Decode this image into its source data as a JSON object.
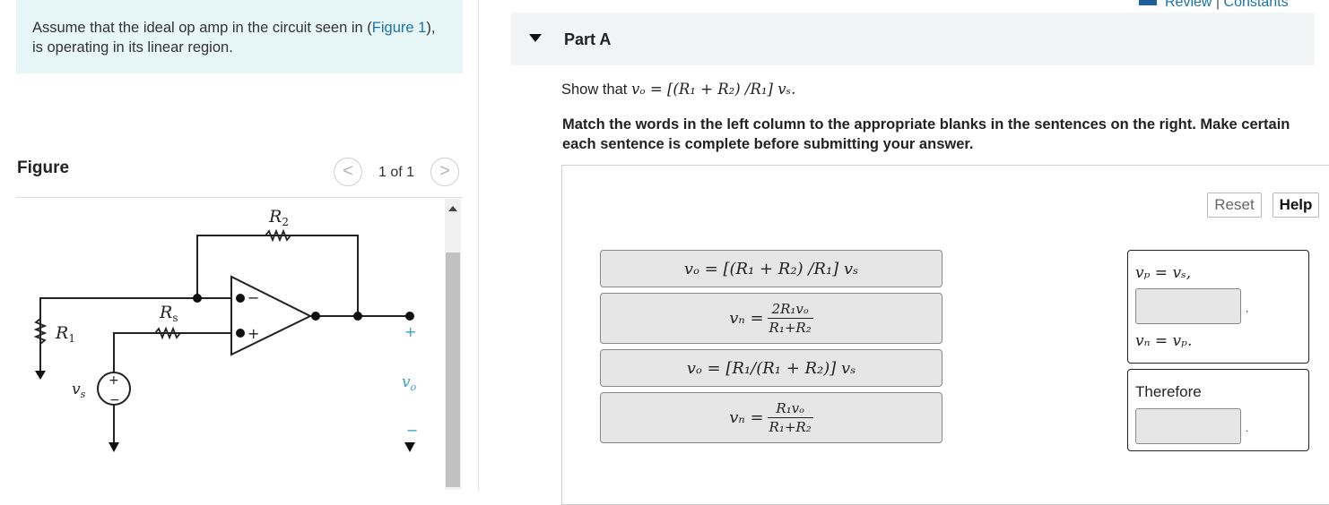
{
  "intro": {
    "text_before_link": "Assume that the ideal op amp in the circuit seen in (",
    "link": "Figure 1",
    "text_after_link": "), is operating in its linear region."
  },
  "figure": {
    "label": "Figure",
    "pager": {
      "count": "1 of 1",
      "prev": "<",
      "next": ">"
    },
    "circuit_labels": {
      "r2": "R",
      "r2_sub": "2",
      "rs": "R",
      "rs_sub": "s",
      "r1": "R",
      "r1_sub": "1",
      "vs": "v",
      "vs_sub": "s",
      "vo": "v",
      "vo_sub": "o",
      "plus": "+",
      "minus": "−"
    },
    "icons": [
      "scroll-up-icon"
    ]
  },
  "header": {
    "review": "Review",
    "separator": "|",
    "constants": "Constants"
  },
  "part": {
    "title": "Part A",
    "show_prefix": "Show that ",
    "show_equation": "vₒ = [(R₁ + R₂) /R₁] vₛ.",
    "instructions": "Match the words in the left column to the appropriate blanks in the sentences on the right. Make certain each sentence is complete before submitting your answer."
  },
  "buttons": {
    "reset": "Reset",
    "help": "Help"
  },
  "tiles": [
    {
      "kind": "eq",
      "text": "vₒ = [(R₁ + R₂) /R₁] vₛ"
    },
    {
      "kind": "frac",
      "lhs": "vₙ =",
      "num": "2R₁vₒ",
      "den": "R₁+R₂"
    },
    {
      "kind": "eq",
      "text": "vₒ = [R₁/(R₁ + R₂)] vₛ"
    },
    {
      "kind": "frac",
      "lhs": "vₙ =",
      "num": "R₁vₒ",
      "den": "R₁+R₂"
    }
  ],
  "targets": {
    "box1": {
      "line1": "vₚ = vₛ,",
      "after_blank": ",",
      "line2": "vₙ = vₚ."
    },
    "box2": {
      "line1": "Therefore",
      "after_blank": "."
    }
  }
}
